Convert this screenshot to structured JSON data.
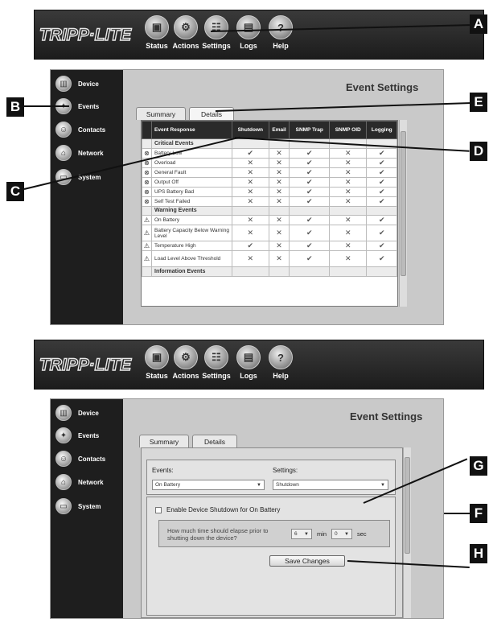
{
  "header": {
    "logo": "TRIPP·LITE",
    "nav": [
      {
        "label": "Status",
        "icon": "status-icon"
      },
      {
        "label": "Actions",
        "icon": "actions-icon"
      },
      {
        "label": "Settings",
        "icon": "settings-icon"
      },
      {
        "label": "Logs",
        "icon": "logs-icon"
      },
      {
        "label": "Help",
        "icon": "help-icon",
        "glyph": "?"
      }
    ]
  },
  "sidebar": {
    "items": [
      "Device",
      "Events",
      "Contacts",
      "Network",
      "System"
    ]
  },
  "panel1": {
    "title": "Event Settings",
    "tabs": [
      "Summary",
      "Details"
    ],
    "columns": [
      "Event Response",
      "Shutdown",
      "Email",
      "SNMP Trap",
      "SNMP OID",
      "Logging"
    ],
    "sections": [
      {
        "title": "Critical Events",
        "rows": [
          {
            "name": "Battery Low",
            "vals": [
              1,
              0,
              1,
              0,
              1
            ]
          },
          {
            "name": "Overload",
            "vals": [
              0,
              0,
              1,
              0,
              1
            ]
          },
          {
            "name": "General Fault",
            "vals": [
              0,
              0,
              1,
              0,
              1
            ]
          },
          {
            "name": "Output Off",
            "vals": [
              0,
              0,
              1,
              0,
              1
            ]
          },
          {
            "name": "UPS Battery Bad",
            "vals": [
              0,
              0,
              1,
              0,
              1
            ]
          },
          {
            "name": "Self Test Failed",
            "vals": [
              0,
              0,
              1,
              0,
              1
            ]
          }
        ]
      },
      {
        "title": "Warning Events",
        "rows": [
          {
            "name": "On Battery",
            "vals": [
              0,
              0,
              1,
              0,
              1
            ]
          },
          {
            "name": "Battery Capacity Below Warning Level",
            "vals": [
              0,
              0,
              1,
              0,
              1
            ]
          },
          {
            "name": "Temperature High",
            "vals": [
              1,
              0,
              1,
              0,
              1
            ]
          },
          {
            "name": "Load Level Above Threshold",
            "vals": [
              0,
              0,
              1,
              0,
              1
            ]
          }
        ]
      },
      {
        "title": "Information Events",
        "rows": []
      }
    ]
  },
  "panel2": {
    "title": "Event Settings",
    "tabs": [
      "Summary",
      "Details"
    ],
    "events_label": "Events:",
    "settings_label": "Settings:",
    "events_value": "On Battery",
    "settings_value": "Shutdown",
    "checkbox_label": "Enable Device Shutdown for On Battery",
    "question": "How much time should elapse prior to shutting down the device?",
    "min_value": "6",
    "min_label": "min",
    "sec_value": "0",
    "sec_label": "sec",
    "save_label": "Save Changes"
  },
  "callouts": [
    "A",
    "B",
    "C",
    "D",
    "E",
    "F",
    "G",
    "H"
  ]
}
